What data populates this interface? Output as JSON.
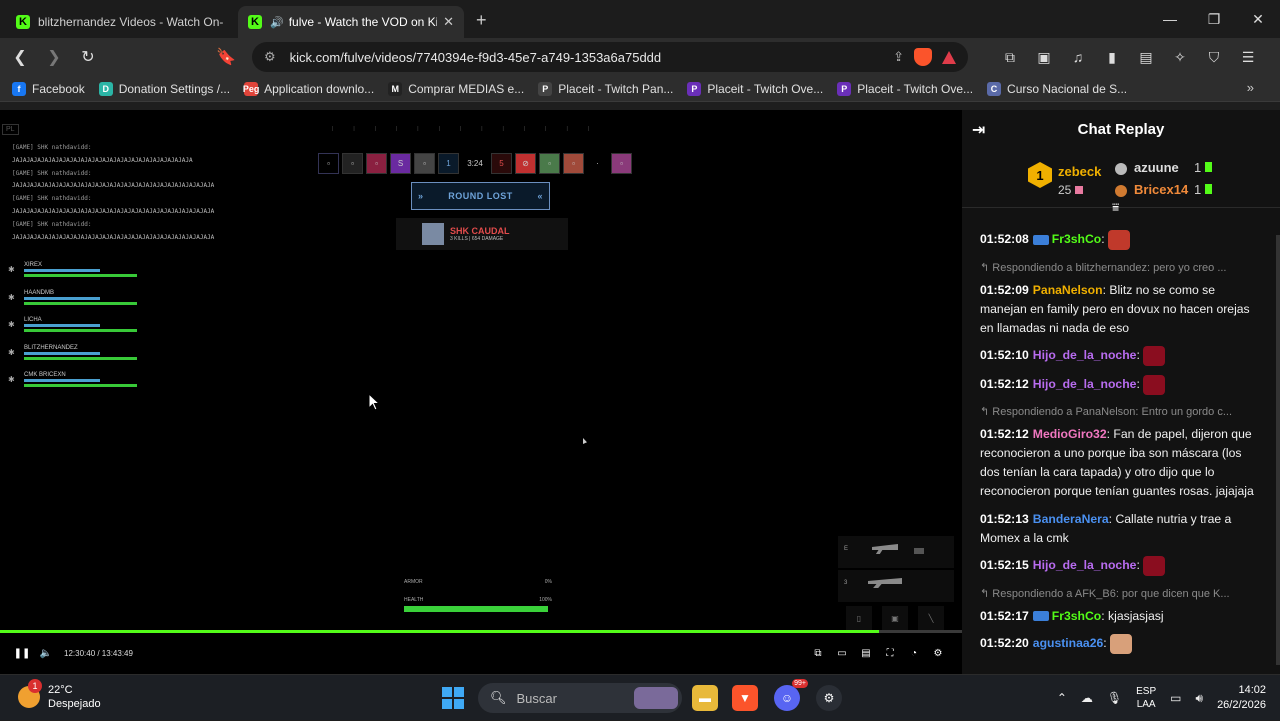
{
  "tabs": [
    {
      "title": "blitzhernandez Videos - Watch On-Dema",
      "active": false
    },
    {
      "title": "fulve - Watch the VOD on Kick",
      "active": true
    }
  ],
  "address": {
    "url": "kick.com/fulve/videos/7740394e-f9d3-45e7-a749-1353a6a75ddd"
  },
  "bookmarks": [
    {
      "label": "Facebook",
      "color": "#1877f2",
      "glyph": "f"
    },
    {
      "label": "Donation Settings /...",
      "color": "#2bb5a6",
      "glyph": "D"
    },
    {
      "label": "Application downlo...",
      "color": "#e0443a",
      "glyph": "Peg"
    },
    {
      "label": "Comprar MEDIAS e...",
      "color": "#222222",
      "glyph": "M"
    },
    {
      "label": "Placeit - Twitch Pan...",
      "color": "#444444",
      "glyph": "P"
    },
    {
      "label": "Placeit - Twitch Ove...",
      "color": "#6a2fb8",
      "glyph": "P"
    },
    {
      "label": "Placeit - Twitch Ove...",
      "color": "#6a2fb8",
      "glyph": "P"
    },
    {
      "label": "Curso Nacional de S...",
      "color": "#5a6aa8",
      "glyph": "C"
    }
  ],
  "game": {
    "killfeed": [
      {
        "line1": "[GAME] SHK nathdavidd:",
        "line2": "JAJAJAJAJAJAJAJAJAJAJAJAJAJAJAJAJAJAJAJAJAJAJAJAJA"
      },
      {
        "line1": "[GAME] SHK nathdavidd:",
        "line2": "JAJAJAJAJAJAJAJAJAJAJAJAJAJAJAJAJAJAJAJAJAJAJAJAJAJAJAJA"
      },
      {
        "line1": "[GAME] SHK nathdavidd:",
        "line2": "JAJAJAJAJAJAJAJAJAJAJAJAJAJAJAJAJAJAJAJAJAJAJAJAJAJAJAJA"
      },
      {
        "line1": "[GAME] SHK nathdavidd:",
        "line2": "JAJAJAJAJAJAJAJAJAJAJAJAJAJAJAJAJAJAJAJAJAJAJAJAJAJAJAJA"
      }
    ],
    "score_left": "1",
    "timer": "3:24",
    "score_right": "5",
    "round_status": "ROUND LOST",
    "mvp_name": "SHK CAUDAL",
    "mvp_stat": "3 KILLS | 654 DAMAGE",
    "players": [
      {
        "name": "XIREX"
      },
      {
        "name": "HAANDMB"
      },
      {
        "name": "LICHA"
      },
      {
        "name": "BLITZHERNANDEZ"
      },
      {
        "name": "CMK BRICEXN"
      }
    ],
    "armor_label": "ARMOR",
    "armor_value": "0%",
    "health_label": "HEALTH",
    "health_value": "100%",
    "health_fraction": 1.0
  },
  "player": {
    "time": "12:30:40 / 13:43:49",
    "progress_fraction": 0.914
  },
  "chat": {
    "title": "Chat Replay",
    "top_gifters": [
      {
        "rank": "1",
        "name": "zebeck",
        "count": "25"
      },
      {
        "name": "azuune",
        "count": "1"
      },
      {
        "name": "Bricex14",
        "count": "1"
      }
    ],
    "messages": [
      {
        "reply": "",
        "time": "01:52:08",
        "user": "Fr3shCo",
        "color": "#53fc18",
        "text": "",
        "emote": "#c0392b"
      },
      {
        "reply": "Respondiendo a blitzhernandez: pero yo creo ...",
        "time": "01:52:09",
        "user": "PanaNelson",
        "color": "#f0b000",
        "text": "Blitz no se como se manejan en family pero en dovux no hacen orejas en llamadas ni nada de eso",
        "emote": ""
      },
      {
        "reply": "",
        "time": "01:52:10",
        "user": "Hijo_de_la_noche",
        "color": "#b86cf0",
        "text": "",
        "emote": "#8a0d1f"
      },
      {
        "reply": "",
        "time": "01:52:12",
        "user": "Hijo_de_la_noche",
        "color": "#b86cf0",
        "text": "",
        "emote": "#8a0d1f"
      },
      {
        "reply": "Respondiendo a PanaNelson: Entro un gordo c...",
        "time": "01:52:12",
        "user": "MedioGiro32",
        "color": "#f077c0",
        "text": "Fan de papel, dijeron que reconocieron a uno porque iba son máscara (los dos tenían la cara tapada) y otro dijo que lo reconocieron porque tenían guantes rosas. jajajaja",
        "emote": ""
      },
      {
        "reply": "",
        "time": "01:52:13",
        "user": "BanderaNera",
        "color": "#4a90f0",
        "text": "Callate nutria y trae a Momex a la cmk",
        "emote": ""
      },
      {
        "reply": "",
        "time": "01:52:15",
        "user": "Hijo_de_la_noche",
        "color": "#b86cf0",
        "text": "",
        "emote": "#8a0d1f"
      },
      {
        "reply": "Respondiendo a AFK_B6: por que dicen que K...",
        "time": "01:52:17",
        "user": "Fr3shCo",
        "color": "#53fc18",
        "text": "kjasjasjasj",
        "emote": ""
      },
      {
        "reply": "",
        "time": "01:52:20",
        "user": "agustinaa26",
        "color": "#4a90f0",
        "text": "",
        "emote": "#d8a07a"
      }
    ]
  },
  "taskbar": {
    "notif_count": "1",
    "temp": "22°C",
    "weather": "Despejado",
    "search_placeholder": "Buscar",
    "discord_badge": "99+",
    "lang1": "ESP",
    "lang2": "LAA",
    "time": "14:02",
    "date": "26/2/2026"
  }
}
